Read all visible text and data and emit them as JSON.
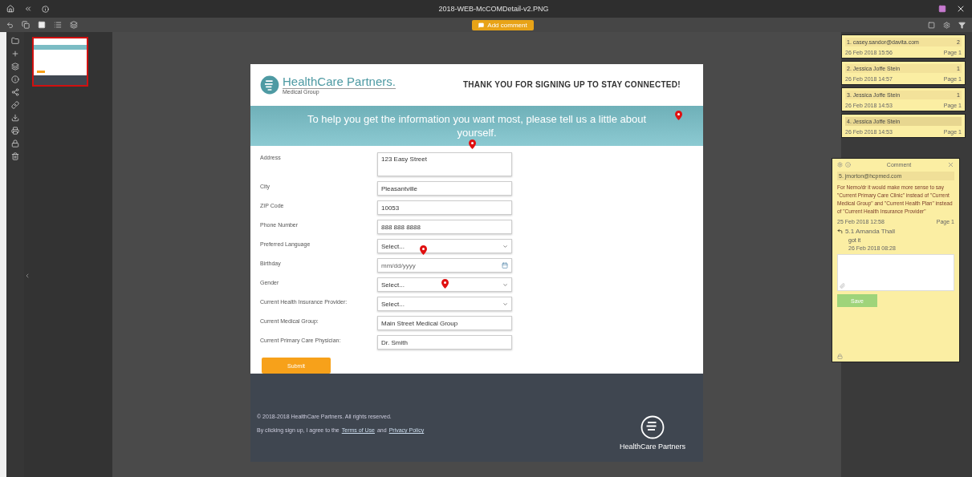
{
  "window": {
    "title": "2018-WEB-McCOMDetail-v2.PNG"
  },
  "toolbar": {
    "add_comment": "Add comment"
  },
  "thumbnails": [
    {
      "selected": true
    }
  ],
  "page": {
    "logo": {
      "name": "HealthCare Partners",
      "suffix": ".",
      "sub": "Medical Group"
    },
    "header": "THANK YOU FOR SIGNING UP TO STAY CONNECTED!",
    "banner": "To help you get the information you want most, please tell us a little about yourself.",
    "fields": [
      {
        "kind": "textarea",
        "label": "Address",
        "value": "123 Easy Street"
      },
      {
        "kind": "text",
        "label": "City",
        "value": "Pleasantville"
      },
      {
        "kind": "text",
        "label": "ZIP Code",
        "value": "10053"
      },
      {
        "kind": "text",
        "label": "Phone Number",
        "value": "888 888 8888"
      },
      {
        "kind": "select",
        "label": "Preferred Language",
        "value": "Select..."
      },
      {
        "kind": "date",
        "label": "Birthday",
        "placeholder": "mm/dd/yyyy"
      },
      {
        "kind": "select",
        "label": "Gender",
        "value": "Select..."
      },
      {
        "kind": "select",
        "label": "Current Health Insurance Provider:",
        "value": "Select..."
      },
      {
        "kind": "text",
        "label": "Current Medical Group:",
        "value": "Main Street Medical Group"
      },
      {
        "kind": "text",
        "label": "Current Primary Care Physician:",
        "value": "Dr. Smith"
      }
    ],
    "submit": "Submit",
    "footer": {
      "copyright": "© 2018-2018 HealthCare Partners. All rights reserved.",
      "consent_before": "By clicking sign up, I agree to the",
      "terms": "Terms of Use",
      "and": "and",
      "privacy": "Privacy Policy",
      "logo": "HealthCare Partners"
    }
  },
  "comments": [
    {
      "title": "1. casey.sandor@davita.com",
      "replies": "2",
      "date": "26 Feb 2018 15:56",
      "page": "Page 1",
      "selected": false
    },
    {
      "title": "2. Jessica Joffe Stein",
      "replies": "1",
      "date": "26 Feb 2018 14:57",
      "page": "Page 1",
      "selected": false
    },
    {
      "title": "3. Jessica Joffe Stein",
      "replies": "1",
      "date": "26 Feb 2018 14:53",
      "page": "Page 1",
      "selected": false
    },
    {
      "title": "4. Jessica Joffe Stein",
      "date": "26 Feb 2018 14:53",
      "page": "Page 1",
      "selected": true
    }
  ],
  "comment_popup": {
    "title": "Comment",
    "author": "5. jmorton@hcpmed.com",
    "body": "For Nemo/dr it would make more sense to say \"Current Primary Care Clinic\" instead of \"Current Medical Group\" and \"Current Health Plan\" instead of \"Current Health Insurance Provider\"",
    "date": "25 Feb 2018 12:58",
    "page": "Page 1",
    "reply": {
      "author": "5.1 Amanda Thall",
      "text": "got it",
      "date": "26 Feb 2018 08:28"
    },
    "save": "Save"
  }
}
